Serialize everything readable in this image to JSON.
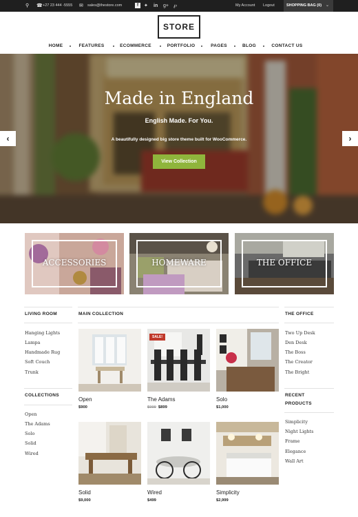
{
  "topbar": {
    "phone": "+27 23 444 -5555",
    "email": "sales@thestore.com",
    "account": "My Account",
    "logout": "Logout",
    "bag": "SHOPPING BAG (0)"
  },
  "logo": "STORE",
  "nav": [
    "HOME",
    "FEATURES",
    "ECOMMERCE",
    "PORTFOLIO",
    "PAGES",
    "BLOG",
    "CONTACT US"
  ],
  "hero": {
    "title": "Made in England",
    "subtitle": "English Made. For You.",
    "description": "A beautifully designed big store theme built for WooCommerce.",
    "button": "View Collection"
  },
  "categories": [
    "ACCESSORIES",
    "HOMEWARE",
    "THE OFFICE"
  ],
  "left": {
    "living_title": "LIVING ROOM",
    "living_links": [
      "Hanging Lights",
      "Lampa",
      "Handmade Rug",
      "Soft Couch",
      "Trunk"
    ],
    "collections_title": "COLLECTIONS",
    "collection_links": [
      "Open",
      "The Adams",
      "Solo",
      "Solid",
      "Wired"
    ]
  },
  "main": {
    "title": "MAIN COLLECTION",
    "sale_badge": "SALE!",
    "products": [
      {
        "name": "Open",
        "price": "$900",
        "old_price": ""
      },
      {
        "name": "The Adams",
        "price": "$899",
        "old_price": "$999"
      },
      {
        "name": "Solo",
        "price": "$1,000",
        "old_price": ""
      },
      {
        "name": "Solid",
        "price": "$9,000",
        "old_price": ""
      },
      {
        "name": "Wired",
        "price": "$499",
        "old_price": ""
      },
      {
        "name": "Simplicity",
        "price": "$2,999",
        "old_price": ""
      }
    ]
  },
  "right": {
    "office_title": "THE OFFICE",
    "office_links": [
      "Two Up Desk",
      "Den Desk",
      "The Boss",
      "The Creator",
      "The Bright"
    ],
    "recent_title_1": "RECENT",
    "recent_title_2": "PRODUCTS",
    "recent_links": [
      "Simplicity",
      "Night Lights",
      "Frame",
      "Elegance",
      "Wall Art"
    ]
  }
}
